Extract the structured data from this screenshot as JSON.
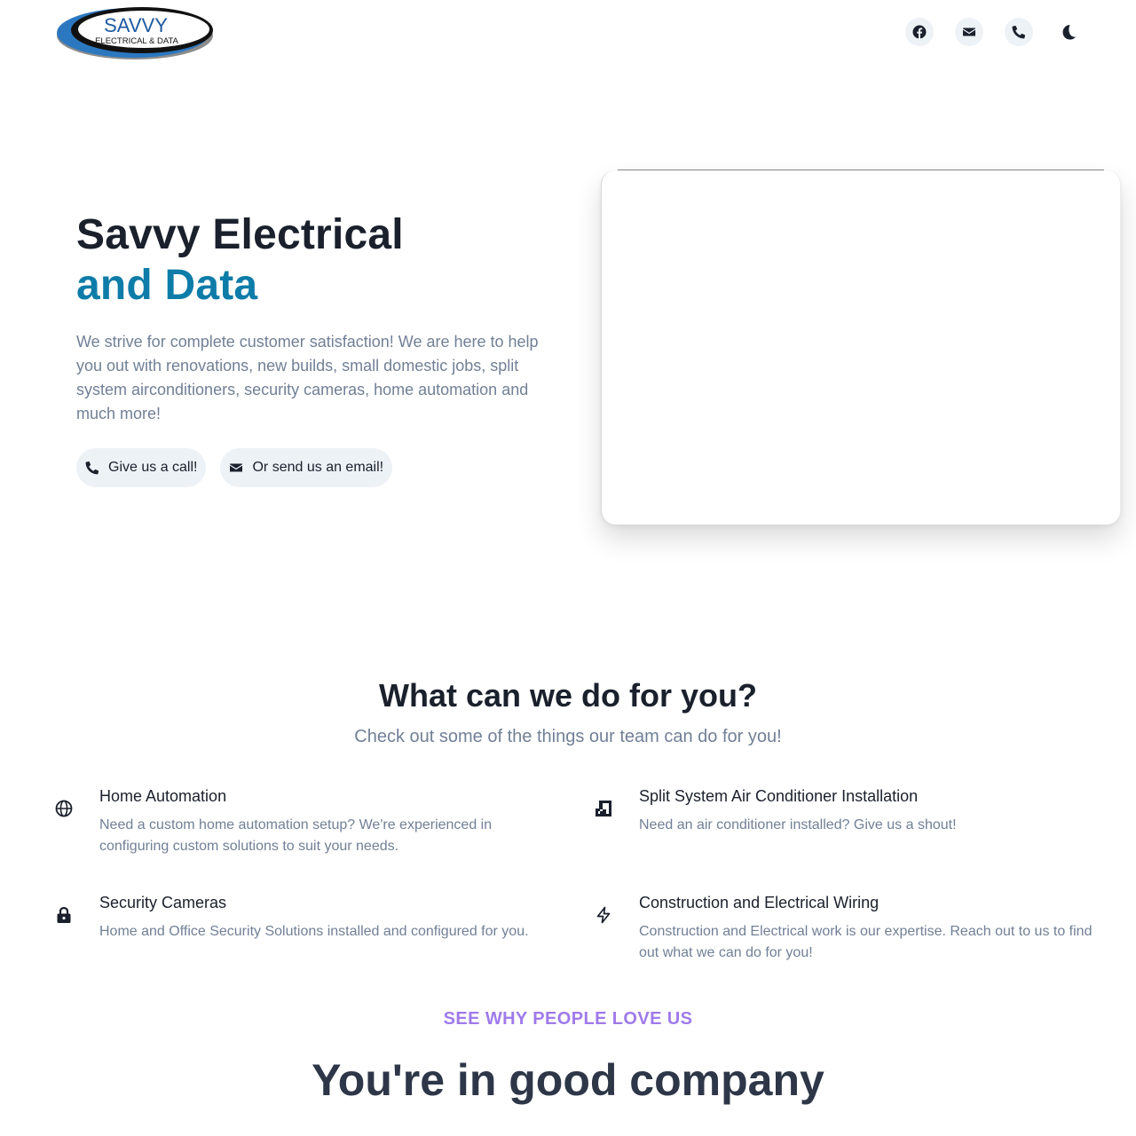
{
  "header": {
    "logo": {
      "brand": "SAVVY",
      "tagline": "ELECTRICAL & DATA"
    },
    "icons": [
      "facebook-icon",
      "email-icon",
      "phone-icon",
      "moon-icon"
    ]
  },
  "hero": {
    "title_line1": "Savvy Electrical",
    "title_line2": "and Data",
    "description": "We strive for complete customer satisfaction! We are here to help you out with renovations, new builds, small domestic jobs, split system airconditioners, security cameras, home automation and much more!",
    "call_label": "Give us a call!",
    "email_label": "Or send us an email!"
  },
  "services": {
    "title": "What can we do for you?",
    "subtitle": "Check out some of the things our team can do for you!",
    "items": [
      {
        "icon": "globe-icon",
        "title": "Home Automation",
        "description": "Need a custom home automation setup? We're experienced in configuring custom solutions to suit your needs."
      },
      {
        "icon": "air-conditioner-icon",
        "title": "Split System Air Conditioner Installation",
        "description": "Need an air conditioner installed? Give us a shout!"
      },
      {
        "icon": "lock-icon",
        "title": "Security Cameras",
        "description": "Home and Office Security Solutions installed and configured for you."
      },
      {
        "icon": "lightning-icon",
        "title": "Construction and Electrical Wiring",
        "description": "Construction and Electrical work is our expertise. Reach out to us to find out what we can do for you!"
      }
    ]
  },
  "testimonials": {
    "eyebrow": "SEE WHY PEOPLE LOVE US",
    "title": "You're in good company"
  },
  "colors": {
    "accent": "#0e7ca8",
    "eyebrow": "#9f7aea",
    "muted_text": "#718096",
    "button_bg": "#edf2f7"
  }
}
